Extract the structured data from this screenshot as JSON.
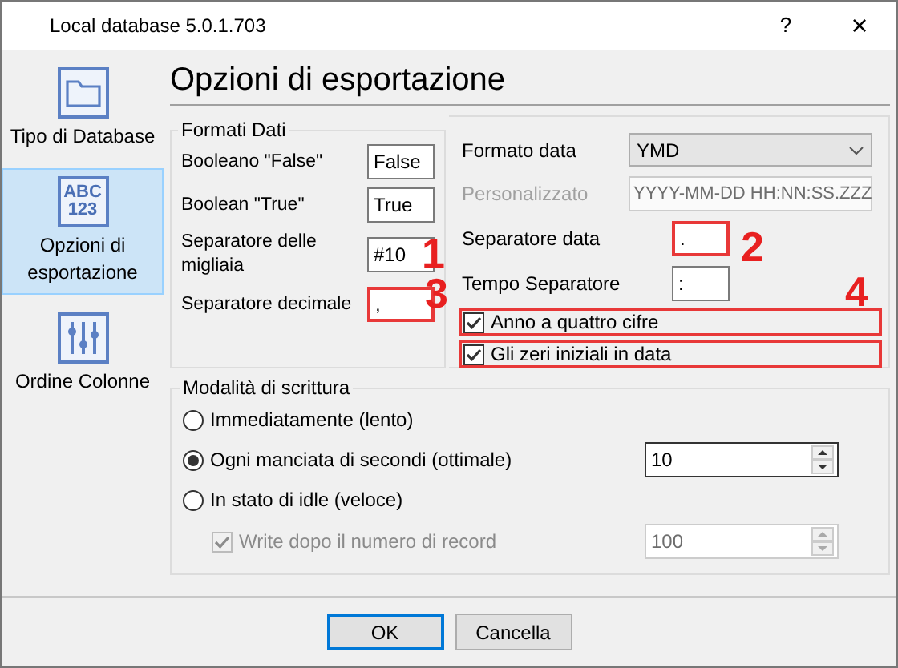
{
  "window": {
    "title": "Local database 5.0.1.703",
    "help": "?",
    "close": "×"
  },
  "sidebar": {
    "items": [
      {
        "label": "Tipo di Database",
        "kind": "folder",
        "selected": false
      },
      {
        "label": "Opzioni di esportazione",
        "kind": "text",
        "icon_text": [
          "ABC",
          "123"
        ],
        "selected": true
      },
      {
        "label": "Ordine Colonne",
        "kind": "sliders",
        "selected": false
      }
    ]
  },
  "page_title": "Opzioni di esportazione",
  "formati_dati": {
    "legend": "Formati Dati",
    "left_fields": [
      {
        "label": "Booleano \"False\"",
        "value": "False",
        "highlighted": false
      },
      {
        "label": "Boolean \"True\"",
        "value": "True",
        "highlighted": false
      },
      {
        "label": "Separatore delle migliaia",
        "value": "#10",
        "highlighted": false
      },
      {
        "label": "Separatore decimale",
        "value": ",",
        "highlighted": true
      }
    ],
    "date_format": {
      "label": "Formato data",
      "value": "YMD"
    },
    "custom": {
      "label": "Personalizzato",
      "value": "YYYY-MM-DD HH:NN:SS.ZZZ",
      "disabled": true
    },
    "right_fields": [
      {
        "label": "Separatore data",
        "value": ".",
        "highlighted": true
      },
      {
        "label": "Tempo Separatore",
        "value": ":",
        "highlighted": false
      }
    ],
    "checkboxes": [
      {
        "label": "Anno a quattro cifre",
        "checked": true,
        "highlighted": true
      },
      {
        "label": "Gli zeri iniziali in data",
        "checked": true,
        "highlighted": true
      }
    ]
  },
  "modalita": {
    "legend": "Modalità di scrittura",
    "options": [
      {
        "label": "Immediatamente (lento)",
        "selected": false
      },
      {
        "label": "Ogni manciata di secondi (ottimale)",
        "selected": true,
        "value": "10"
      },
      {
        "label": "In stato di idle (veloce)",
        "selected": false
      }
    ],
    "sub_option": {
      "label": "Write dopo il numero di record",
      "checked": true,
      "disabled": true,
      "value": "100"
    }
  },
  "buttons": [
    {
      "label": "OK",
      "default": true
    },
    {
      "label": "Cancella",
      "default": false
    }
  ],
  "annotation_marks": [
    "1",
    "2",
    "3",
    "4"
  ]
}
